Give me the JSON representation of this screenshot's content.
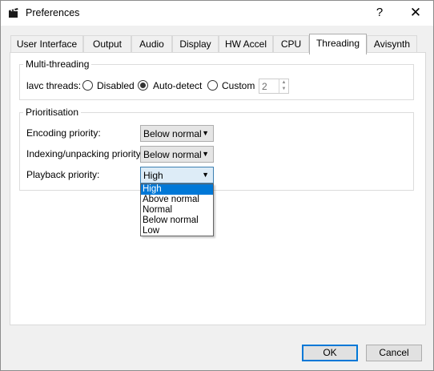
{
  "window": {
    "title": "Preferences",
    "help_symbol": "?",
    "close_symbol": "✕",
    "icon": "clapperboard-icon"
  },
  "tabs": [
    {
      "label": "User Interface"
    },
    {
      "label": "Output"
    },
    {
      "label": "Audio"
    },
    {
      "label": "Display"
    },
    {
      "label": "HW Accel"
    },
    {
      "label": "CPU"
    },
    {
      "label": "Threading",
      "active": true
    },
    {
      "label": "Avisynth"
    }
  ],
  "multithreading": {
    "title": "Multi-threading",
    "lavc_label": "lavc threads:",
    "options": [
      "Disabled",
      "Auto-detect",
      "Custom"
    ],
    "selected": "Auto-detect",
    "custom_value": "2"
  },
  "prioritisation": {
    "title": "Prioritisation",
    "encoding_label": "Encoding priority:",
    "encoding_value": "Below normal",
    "indexing_label": "Indexing/unpacking priority:",
    "indexing_value": "Below normal",
    "playback_label": "Playback priority:",
    "playback_value": "High",
    "playback_options": [
      "High",
      "Above normal",
      "Normal",
      "Below normal",
      "Low"
    ]
  },
  "buttons": {
    "ok": "OK",
    "cancel": "Cancel"
  },
  "colors": {
    "selection": "#0078d7",
    "panel": "#ffffff",
    "background": "#f0f0f0"
  }
}
